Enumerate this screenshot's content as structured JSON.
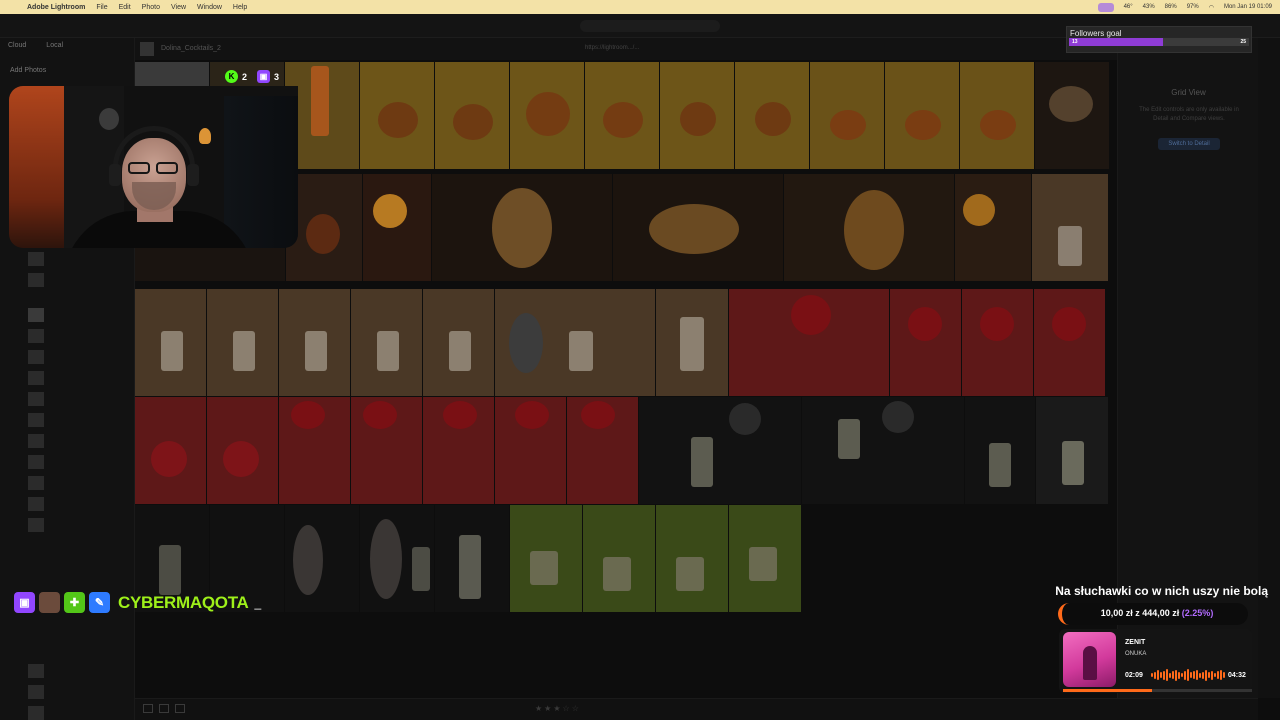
{
  "menubar": {
    "app_name": "Adobe Lightroom",
    "menus": [
      "File",
      "Edit",
      "Photo",
      "View",
      "Window",
      "Help"
    ],
    "battery_1": "46°",
    "battery_2": "43%",
    "battery_3": "86%",
    "battery_4": "97%",
    "datetime": "Mon Jan 19  01:09"
  },
  "lightroom": {
    "tabs": [
      "Cloud",
      "Local"
    ],
    "add_photos": "Add Photos",
    "album_title": "Dolina_Cocktails_2",
    "album_link": "https://lightroom.../...",
    "right_panel": {
      "title": "Grid View",
      "description": "The Edit controls are only available in Detail and Compare views.",
      "button": "Switch to Detail"
    }
  },
  "followers_goal": {
    "label": "Followers goal",
    "current": "13",
    "max": "25",
    "progress": 0.52
  },
  "stream_stats": {
    "kick_count": "2",
    "twitch_count": "3"
  },
  "social": {
    "handle": "CYBERMAQOTA",
    "cursor": "_"
  },
  "donation": {
    "title": "Na słuchawki co w nich uszy nie bolą",
    "amount": "10,00 zł",
    "of": "z",
    "goal": "444,00 zł",
    "percent": "(2.25%)"
  },
  "music": {
    "song": "ZENIT",
    "artist": "ONUKA",
    "current_time": "02:09",
    "total_time": "04:32",
    "progress": 0.47
  },
  "colors": {
    "accent_purple": "#8f3cd6",
    "accent_orange": "#ff6a1a",
    "handle_green": "#9ef01a",
    "kick_green": "#53fc18",
    "twitch_purple": "#9146ff"
  }
}
